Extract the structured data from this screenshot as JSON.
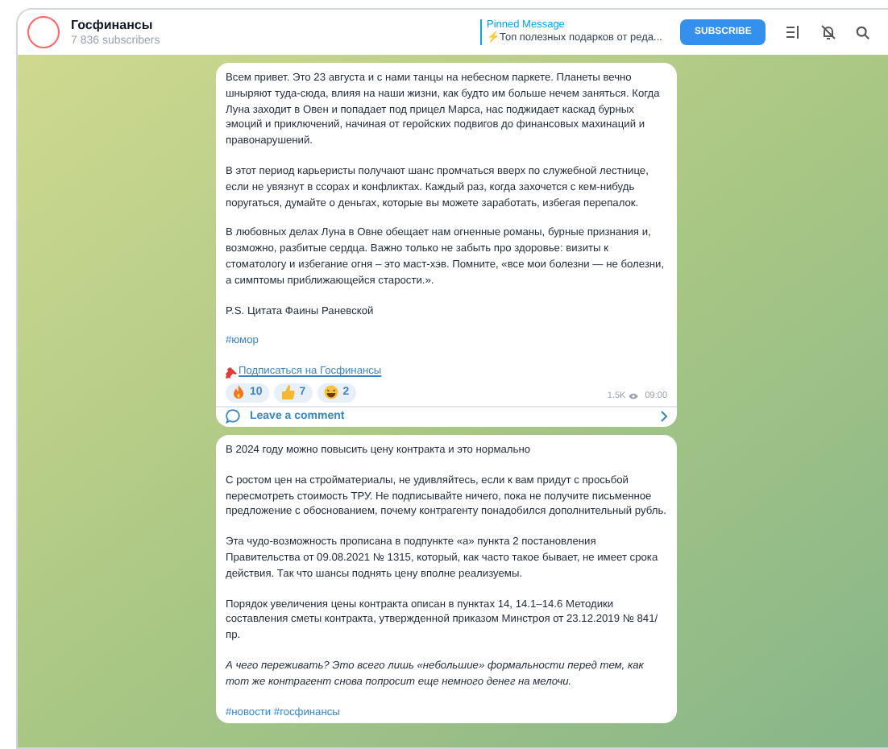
{
  "header": {
    "title": "Госфинансы",
    "subscribers": "7 836 subscribers",
    "pinned": {
      "label": "Pinned Message",
      "text": "⚡Топ полезных подарков от реда..."
    },
    "subscribe_button": "SUBSCRIBE"
  },
  "messages": [
    {
      "paragraphs": [
        {
          "kind": "plain",
          "text": "Всем  привет. Это 23 августа и с нами танцы на небесном паркете. Планеты вечно шныряют туда-сюда, влияя на наши жизни, как будто им больше нечем заняться. Когда Луна заходит в Овен и попадает под прицел Марса, нас поджидает каскад бурных эмоций и приключений, начиная от геройских подвигов до финансовых махинаций и правонарушений."
        },
        {
          "kind": "plain",
          "text": "В этот период карьеристы получают шанс промчаться вверх по служебной лестнице, если не увязнут в ссорах и конфликтах. Каждый раз, когда захочется с кем-нибудь поругаться, думайте о деньгах, которые вы можете заработать, избегая перепалок."
        },
        {
          "kind": "plain",
          "text": "В любовных делах Луна в Овне обещает нам огненные романы, бурные признания и, возможно, разбитые сердца. Важно только не забыть про здоровье: визиты к стоматологу и избегание огня – это маст-хэв. Помните, «все мои болезни — не болезни, а симптомы приближающейся старости.»."
        },
        {
          "kind": "plain",
          "text": "P.S. Цитата Фаины Раневской"
        },
        {
          "kind": "hashtag",
          "text": "#юмор"
        },
        {
          "kind": "link",
          "text": "Подписаться на Госфинансы"
        }
      ],
      "reactions": [
        {
          "kind": "fire",
          "count": "10"
        },
        {
          "kind": "thumb",
          "count": "7"
        },
        {
          "kind": "grin",
          "count": "2"
        }
      ],
      "views": "1.5K",
      "time": "09:00",
      "comment": "Leave a comment"
    },
    {
      "paragraphs": [
        {
          "kind": "plain",
          "text": "В 2024 году можно повысить цену контракта и это нормально"
        },
        {
          "kind": "plain",
          "text": "С ростом цен на стройматериалы, не удивляйтесь, если к вам придут с просьбой пересмотреть стоимость ТРУ. Не подписывайте ничего, пока не получите письменное предложение с обоснованием, почему контрагенту понадобился дополнительный рубль."
        },
        {
          "kind": "plain",
          "text": "Эта чудо-возможность прописана в подпункте «а» пункта 2 постановления Правительства от 09.08.2021 № 1315, который, как часто такое бывает, не имеет срока действия. Так что шансы поднять цену вполне реализуемы."
        },
        {
          "kind": "plain",
          "text": "Порядок увеличения цены контракта описан в пунктах 14, 14.1–14.6 Методики составления сметы контракта, утвержденной приказом Минстроя от 23.12.2019 № 841/пр."
        },
        {
          "kind": "italic",
          "text": "А чего переживать? Это всего лишь «небольшие» формальности перед тем, как тот же контрагент снова попросит еще немного денег на мелочи."
        },
        {
          "kind": "hashtag",
          "text": "#новости #госфинансы"
        }
      ]
    }
  ]
}
